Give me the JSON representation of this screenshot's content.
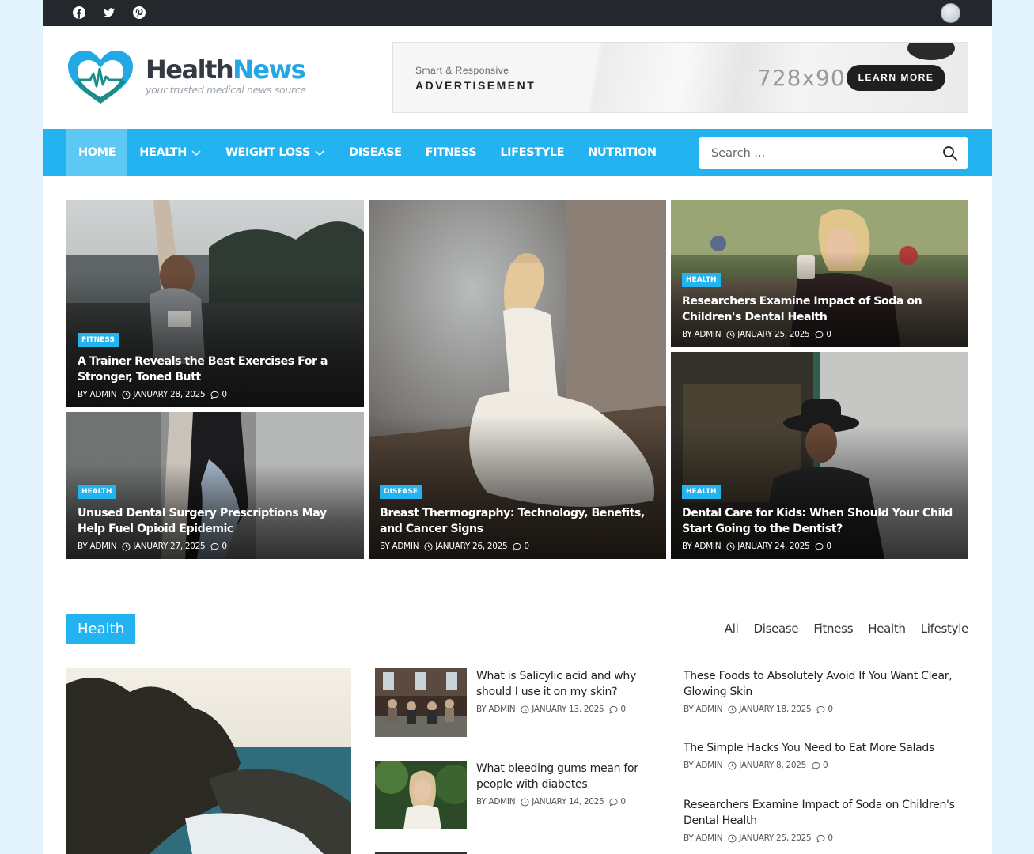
{
  "topbar": {
    "social_icons": [
      "facebook-icon",
      "twitter-icon",
      "pinterest-icon"
    ]
  },
  "logo": {
    "brand_part1": "Health",
    "brand_part2": "News",
    "tagline": "your trusted medical news source"
  },
  "advertisement": {
    "small": "Smart & Responsive",
    "big": "ADVERTISEMENT",
    "size": "728x90",
    "button": "LEARN MORE"
  },
  "nav": {
    "items": [
      {
        "label": "HOME",
        "active": true,
        "dropdown": false
      },
      {
        "label": "HEALTH",
        "dropdown": true
      },
      {
        "label": "WEIGHT LOSS",
        "dropdown": true
      },
      {
        "label": "DISEASE",
        "dropdown": false
      },
      {
        "label": "FITNESS",
        "dropdown": false
      },
      {
        "label": "LIFESTYLE",
        "dropdown": false
      },
      {
        "label": "NUTRITION",
        "dropdown": false
      }
    ],
    "search_placeholder": "Search ..."
  },
  "featured": [
    {
      "tag": "FITNESS",
      "title": "A Trainer Reveals the Best Exercises For a Stronger, Toned Butt",
      "author": "BY ADMIN",
      "date": "JANUARY 28, 2025",
      "comments": "0"
    },
    {
      "tag": "HEALTH",
      "title": "Unused Dental Surgery Prescriptions May Help Fuel Opioid Epidemic",
      "author": "BY ADMIN",
      "date": "JANUARY 27, 2025",
      "comments": "0"
    },
    {
      "tag": "DISEASE",
      "title": "Breast Thermography: Technology, Benefits, and Cancer Signs",
      "author": "BY ADMIN",
      "date": "JANUARY 26, 2025",
      "comments": "0"
    },
    {
      "tag": "HEALTH",
      "title": "Researchers Examine Impact of Soda on Children's Dental Health",
      "author": "BY ADMIN",
      "date": "JANUARY 25, 2025",
      "comments": "0"
    },
    {
      "tag": "HEALTH",
      "title": "Dental Care for Kids: When Should Your Child Start Going to the Dentist?",
      "author": "BY ADMIN",
      "date": "JANUARY 24, 2025",
      "comments": "0"
    }
  ],
  "section": {
    "title": "Health",
    "filters": [
      "All",
      "Disease",
      "Fitness",
      "Health",
      "Lifestyle"
    ],
    "middle": [
      {
        "title": "What is Salicylic acid and why should I use it on my skin?",
        "author": "BY ADMIN",
        "date": "JANUARY 13, 2025",
        "comments": "0"
      },
      {
        "title": "What bleeding gums mean for people with diabetes",
        "author": "BY ADMIN",
        "date": "JANUARY 14, 2025",
        "comments": "0"
      }
    ],
    "right": [
      {
        "title": "These Foods to Absolutely Avoid If You Want Clear, Glowing Skin",
        "author": "BY ADMIN",
        "date": "JANUARY 18, 2025",
        "comments": "0"
      },
      {
        "title": "The Simple Hacks You Need to Eat More Salads",
        "author": "BY ADMIN",
        "date": "JANUARY 8, 2025",
        "comments": "0"
      },
      {
        "title": "Researchers Examine Impact of Soda on Children's Dental Health",
        "author": "BY ADMIN",
        "date": "JANUARY 25, 2025",
        "comments": "0"
      }
    ]
  },
  "colors": {
    "accent": "#22b3f0",
    "topbar": "#24272b",
    "page_bg": "#e3f3fc"
  }
}
